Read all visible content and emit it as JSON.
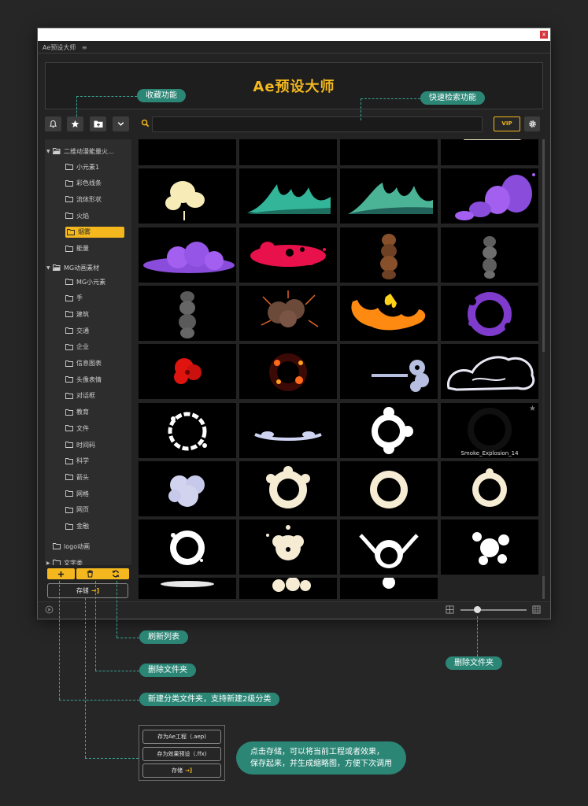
{
  "app": {
    "panel_tab": "Ae预设大师",
    "panel_menu_icon": "≡",
    "close_glyph": "x",
    "banner_title": "Ae预设大师",
    "accent_color": "#f4b81e",
    "teal_color": "#2c8676"
  },
  "toolbar": {
    "icons": [
      "bell-icon",
      "star-icon",
      "folder-plus-icon",
      "chevron-down-icon"
    ],
    "search_icon": "search-icon",
    "vip_label": "VIP",
    "settings_icon": "gear-icon"
  },
  "sidebar": {
    "groups": [
      {
        "label": "二维动漫能量火…",
        "expanded": true,
        "items": [
          "小元素1",
          "彩色线条",
          "流体形状",
          "火焰",
          "烟雾",
          "能量"
        ],
        "selected": "烟雾"
      },
      {
        "label": "MG动画素材",
        "expanded": true,
        "items": [
          "MG小元素",
          "手",
          "建筑",
          "交通",
          "企业",
          "信息图表",
          "头像表情",
          "对话框",
          "教育",
          "文件",
          "时间码",
          "科学",
          "箭头",
          "网格",
          "网页",
          "金融"
        ]
      },
      {
        "label": "logo动画",
        "expanded": false,
        "items": []
      },
      {
        "label": "文字类",
        "expanded": false,
        "items": []
      }
    ],
    "bottom_buttons": [
      "plus-icon",
      "trash-icon",
      "refresh-icon"
    ],
    "save_label": "存储",
    "save_icon": "→]"
  },
  "grid": {
    "hovered_label": "Smoke_Explosion_14",
    "hovered_favorite_glyph": "★"
  },
  "statusbar": {
    "play_icon": "play-circle-icon",
    "small_grid_icon": "grid-small-icon",
    "large_grid_icon": "grid-large-icon",
    "thumbnail_size": 0.2
  },
  "callouts": {
    "favorites": "收藏功能",
    "quick_search": "快速检索功能",
    "refresh_list": "刷新列表",
    "delete_folder": "删除文件夹",
    "new_folder": "新建分类文件夹，支持新建2级分类",
    "slider_note": "删除文件夹",
    "save_note_line1": "点击存储，可以将当前工程或者效果，",
    "save_note_line2": "保存起来，并生成缩略图，方便下次调用"
  },
  "save_menu": {
    "items": [
      "存为Ae工程（.aep)",
      "存为效果预设（.ffx)",
      "存储"
    ]
  }
}
